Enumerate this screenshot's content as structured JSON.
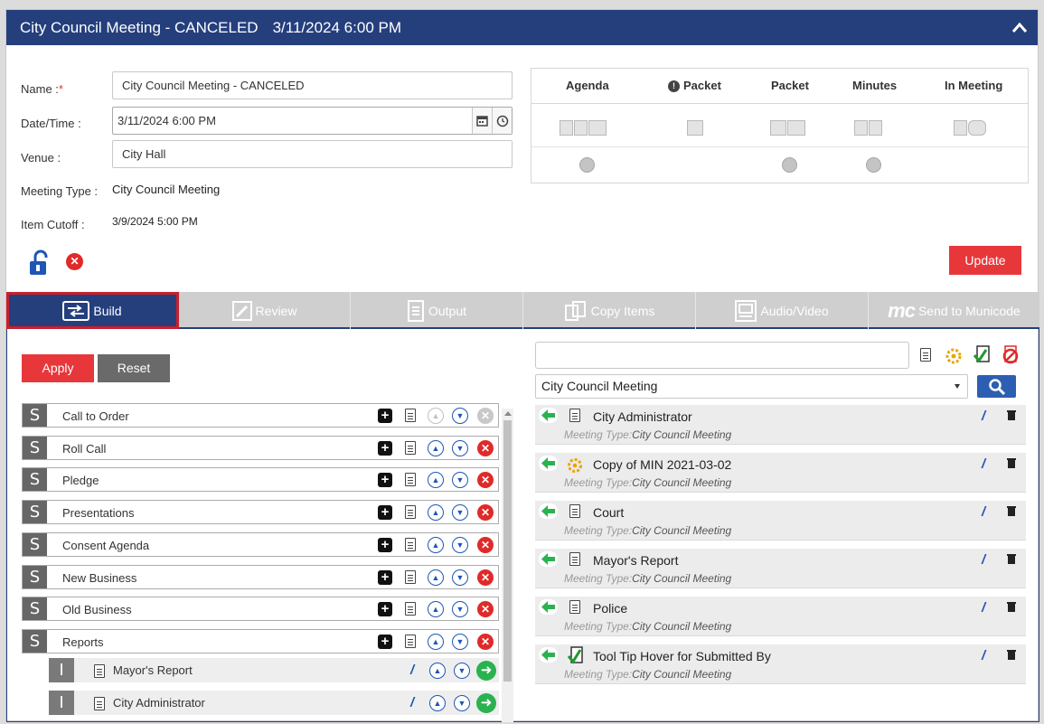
{
  "header": {
    "meeting_name": "City Council Meeting - CANCELED",
    "meeting_datetime": "3/11/2024 6:00 PM"
  },
  "form": {
    "name_label": "Name :",
    "name_required": "*",
    "name_value": "City Council Meeting - CANCELED",
    "datetime_label": "Date/Time :",
    "datetime_value": "3/11/2024 6:00 PM",
    "venue_label": "Venue :",
    "venue_value": "City Hall",
    "meeting_type_label": "Meeting Type :",
    "meeting_type_value": "City Council Meeting",
    "item_cutoff_label": "Item Cutoff :",
    "item_cutoff_value": "3/9/2024 5:00 PM"
  },
  "packet_table": {
    "headers": [
      "Agenda",
      "Packet",
      "Packet",
      "Minutes",
      "In Meeting"
    ],
    "packet_info_marker": "!"
  },
  "update_button": "Update",
  "tabs": [
    {
      "label": "Build",
      "active": true
    },
    {
      "label": "Review"
    },
    {
      "label": "Output"
    },
    {
      "label": "Copy Items"
    },
    {
      "label": "Audio/Video"
    },
    {
      "label": "Send to Municode",
      "logo_text": "mc"
    }
  ],
  "build": {
    "apply_button": "Apply",
    "reset_button": "Reset",
    "section_badge": "S",
    "item_badge": "I",
    "sections": [
      {
        "label": "Call to Order",
        "first": true
      },
      {
        "label": "Roll Call"
      },
      {
        "label": "Pledge"
      },
      {
        "label": "Presentations"
      },
      {
        "label": "Consent Agenda"
      },
      {
        "label": "New Business"
      },
      {
        "label": "Old Business"
      },
      {
        "label": "Reports"
      }
    ],
    "items": [
      {
        "label": "Mayor's Report"
      },
      {
        "label": "City Administrator"
      }
    ]
  },
  "library": {
    "search_value": "",
    "meeting_type_select": "City Council Meeting",
    "meta_label": "Meeting Type:",
    "cards": [
      {
        "title": "City Administrator",
        "icon": "document-icon",
        "meta": "City Council Meeting"
      },
      {
        "title": "Copy of MIN 2021-03-02",
        "icon": "gear-document-icon",
        "meta": "City Council Meeting"
      },
      {
        "title": "Court",
        "icon": "document-icon",
        "meta": "City Council Meeting"
      },
      {
        "title": "Mayor's Report",
        "icon": "document-icon",
        "meta": "City Council Meeting"
      },
      {
        "title": "Police",
        "icon": "document-icon",
        "meta": "City Council Meeting"
      },
      {
        "title": "Tool Tip Hover for Submitted By",
        "icon": "approved-document-icon",
        "meta": "City Council Meeting"
      }
    ]
  },
  "colors": {
    "header_blue": "#253f7d",
    "accent_red": "#e8373b",
    "add_green": "#2ab24f",
    "arrow_blue": "#1f56b5"
  }
}
